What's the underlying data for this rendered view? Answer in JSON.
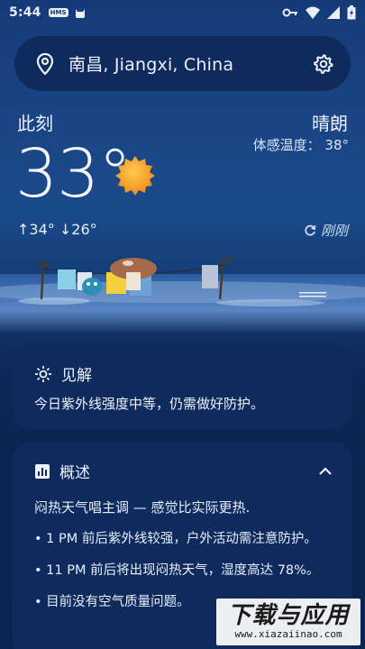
{
  "status_bar": {
    "time": "5:44",
    "left_icons": [
      "hms-icon",
      "cat-icon"
    ],
    "right_icons": [
      "key-icon",
      "wifi-icon",
      "signal-icon",
      "battery-icon"
    ],
    "hms_text": "HMS"
  },
  "search": {
    "location": "南昌, Jiangxi, China"
  },
  "current": {
    "label": "此刻",
    "condition": "晴朗",
    "feels_like": "体感温度： 38°",
    "temperature": "33°",
    "high_low": "↑34° ↓26°",
    "updated": "刚刚"
  },
  "insight": {
    "title": "见解",
    "text": "今日紫外线强度中等，仍需做好防护。"
  },
  "overview": {
    "title": "概述",
    "intro": "闷热天气唱主调 — 感觉比实际更热.",
    "items": [
      "1 PM 前后紫外线较强，户外活动需注意防护。",
      "11 PM 前后将出现闷热天气，湿度高达 78%。",
      "目前没有空气质量问题。"
    ]
  },
  "watermark": {
    "main": "下载与应用",
    "url": "www.xiazaiinao.com"
  },
  "colors": {
    "background_top": "#163a78",
    "card": "#0f2a5d",
    "sun": "#f5a623"
  }
}
